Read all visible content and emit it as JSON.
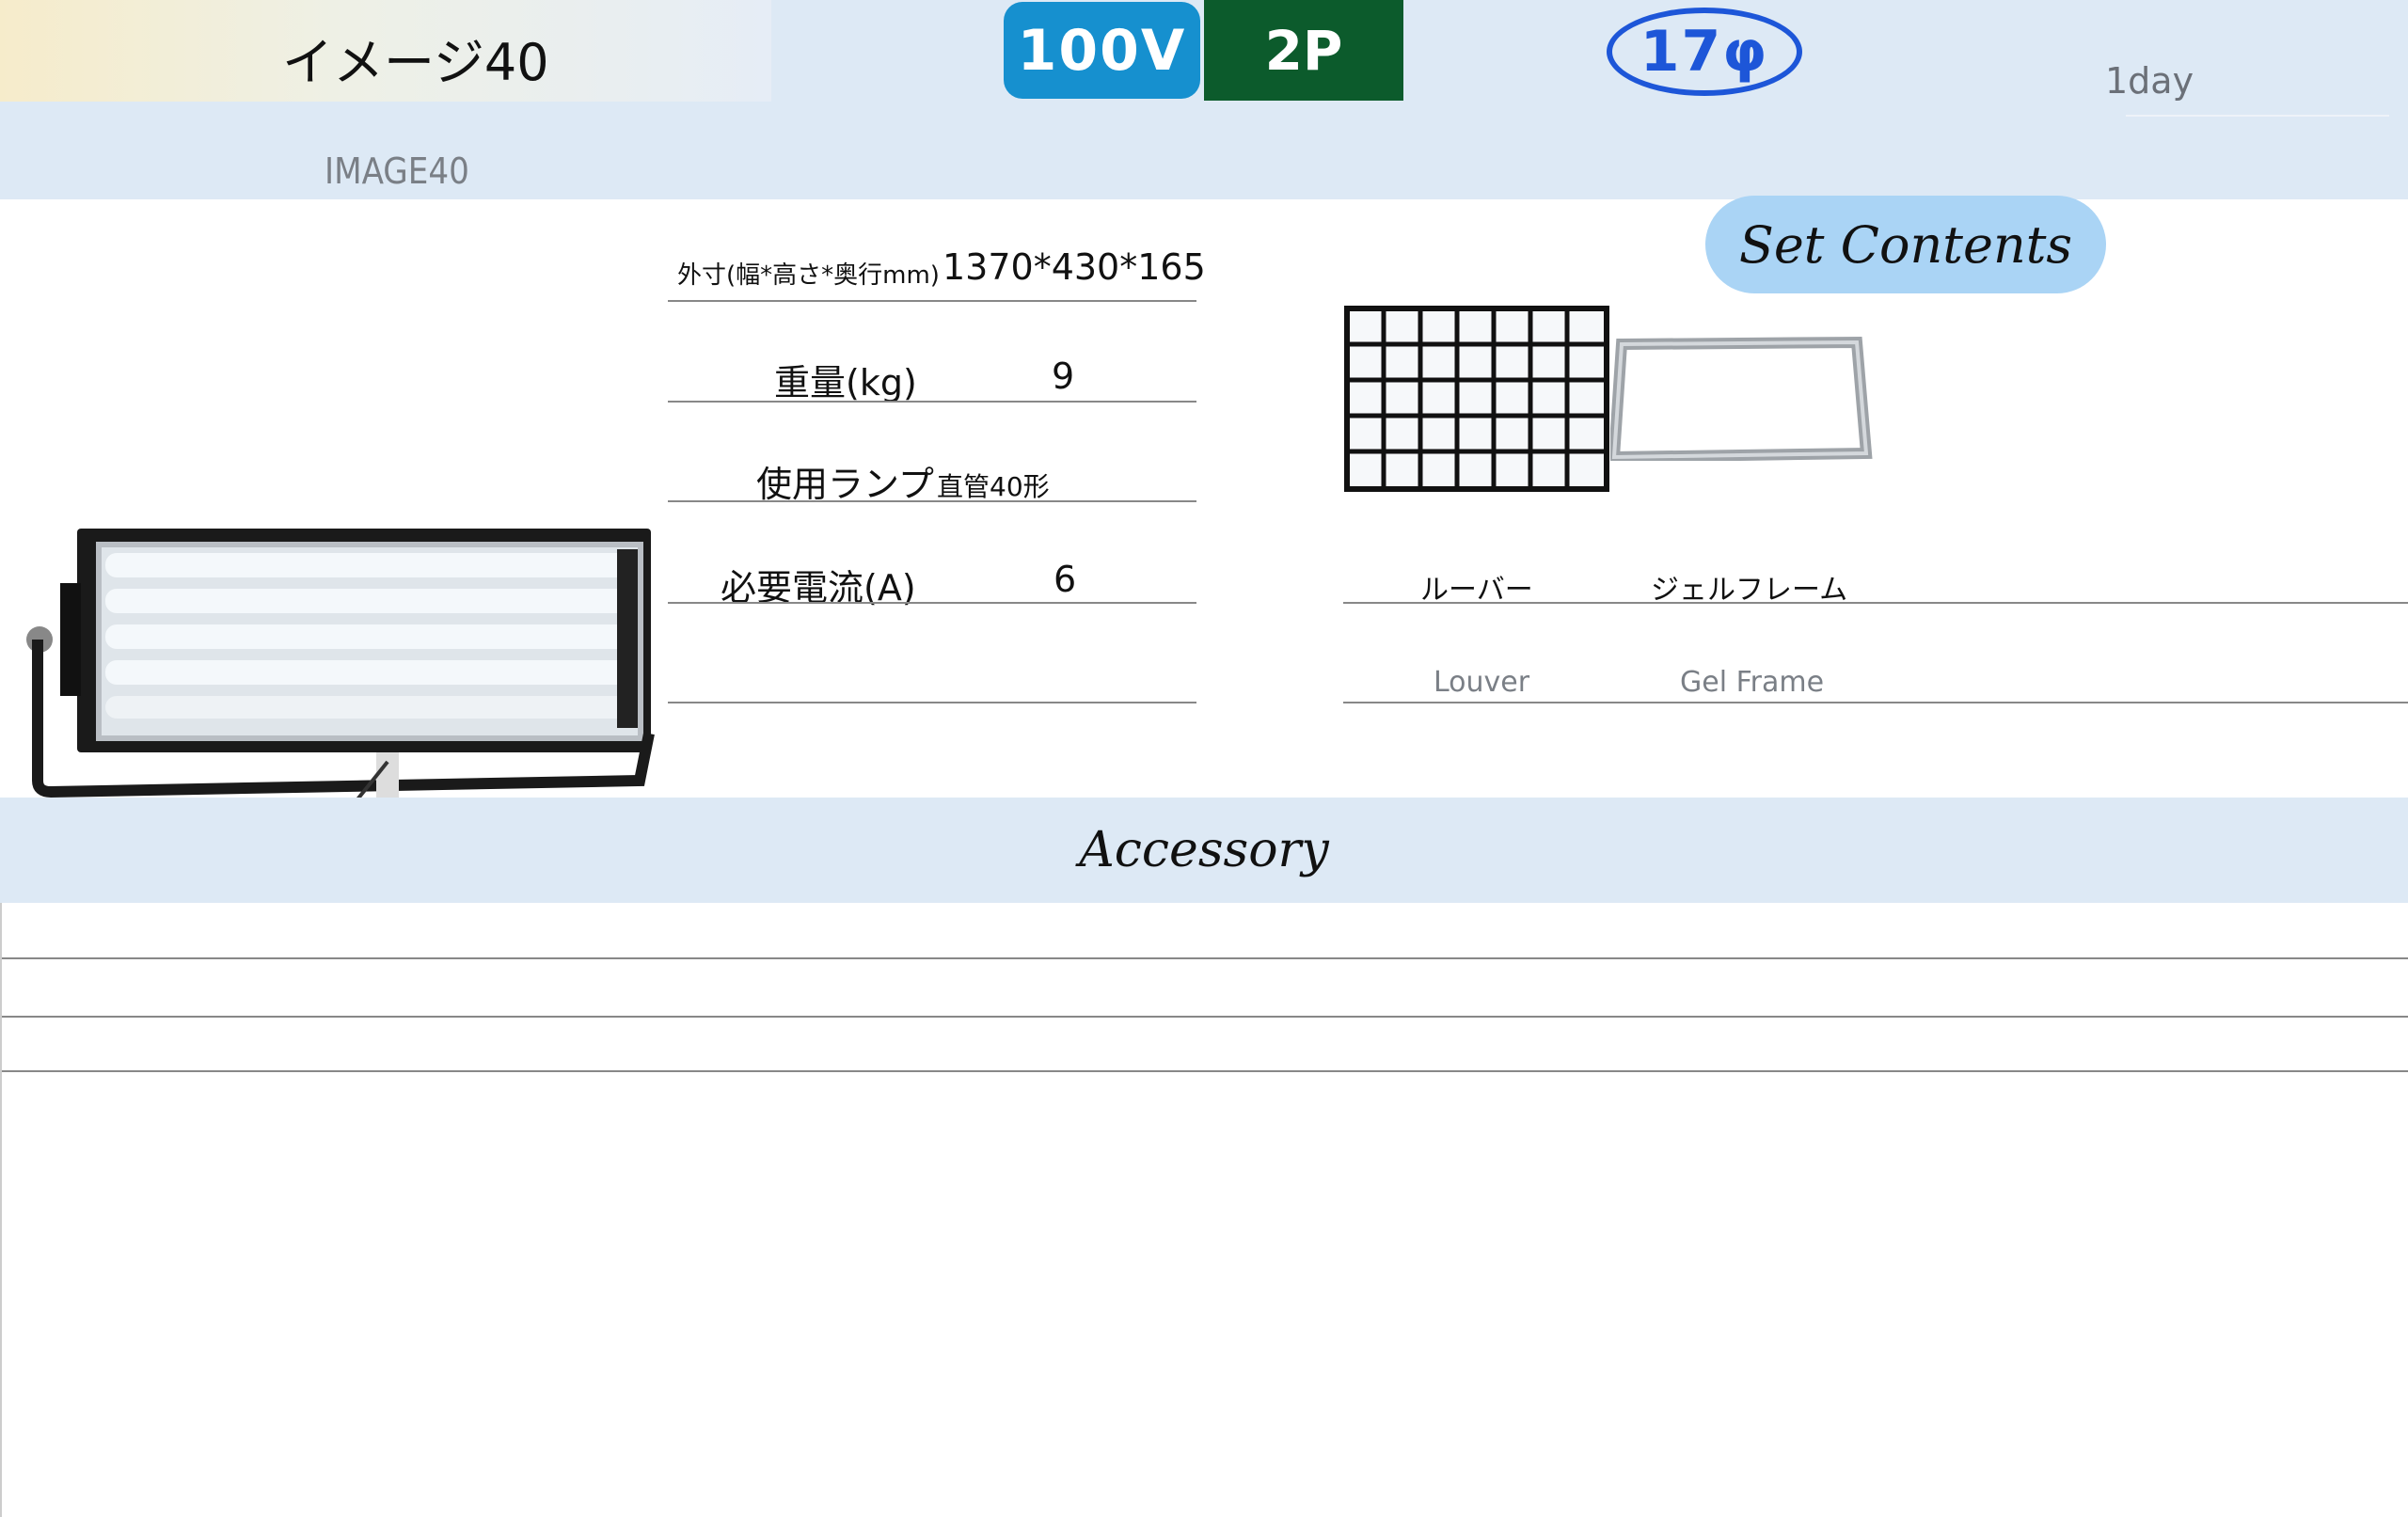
{
  "header": {
    "title": "イメージ40",
    "subtitle": "IMAGE40",
    "voltage": "100V",
    "plug": "2P",
    "size": "17φ",
    "rental": "1day"
  },
  "colors": {
    "voltage_badge": "#1690cf",
    "plug_badge": "#0c5b2c",
    "size_badge": "#1d56d8",
    "band": "#dde9f5",
    "set_contents_pill": "#aad4f5"
  },
  "specs": {
    "dimensions_label": "外寸(幅*高さ*奥行mm)",
    "dimensions_value": "1370*430*165",
    "weight_label": "重量(kg)",
    "weight_value": "9",
    "lamp_label": "使用ランプ",
    "lamp_value": "直管40形",
    "current_label": "必要電流(A)",
    "current_value": "6"
  },
  "set_contents": {
    "heading": "Set Contents",
    "items": [
      {
        "jp": "ルーバー",
        "en": "Louver"
      },
      {
        "jp": "ジェルフレーム",
        "en": "Gel Frame"
      }
    ]
  },
  "accessory": {
    "heading": "Accessory"
  }
}
